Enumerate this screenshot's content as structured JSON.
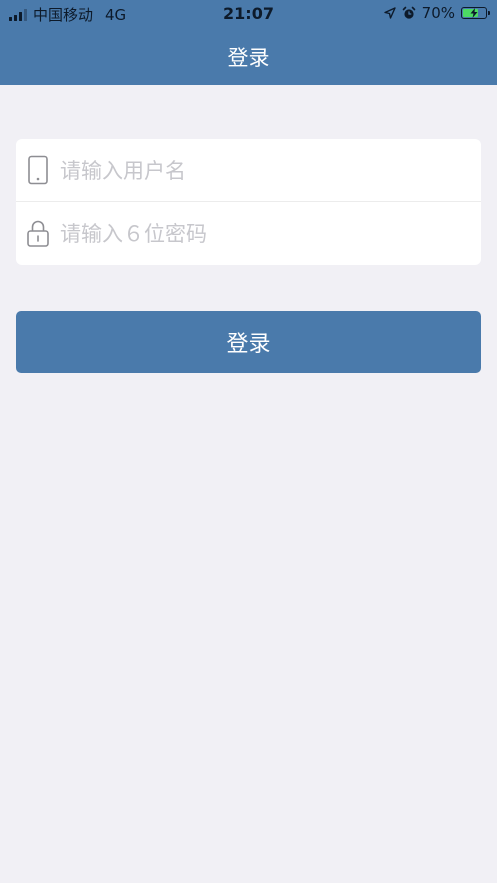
{
  "status_bar": {
    "carrier": "中国移动",
    "network": "4G",
    "time": "21:07",
    "battery_percent_label": "70%",
    "battery_level": 0.7
  },
  "nav": {
    "title": "登录"
  },
  "form": {
    "username_placeholder": "请输入用户名",
    "username_value": "",
    "password_placeholder": "请输入６位密码",
    "password_value": ""
  },
  "login_button_label": "登录",
  "icons": {
    "username": "phone-icon",
    "password": "lock-icon"
  },
  "colors": {
    "primary": "#4a7aab",
    "background": "#f1f0f5",
    "card": "#ffffff",
    "placeholder": "#c7c7cc",
    "icon": "#8e8e93",
    "battery_charging": "#4cd964"
  }
}
